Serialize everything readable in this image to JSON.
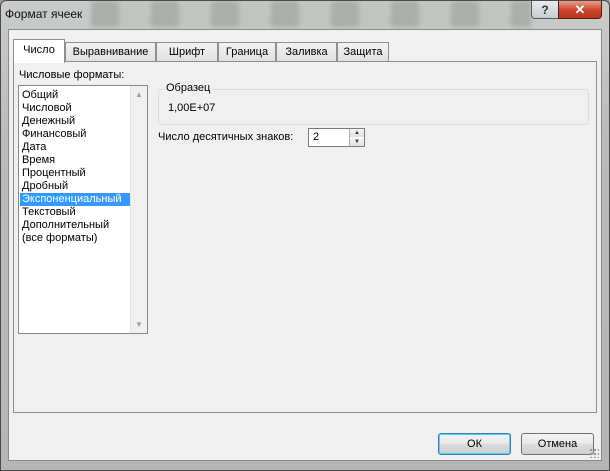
{
  "window": {
    "title": "Формат ячеек",
    "help_label": "?",
    "close_label": "✕"
  },
  "tabs": [
    {
      "label": "Число",
      "active": true
    },
    {
      "label": "Выравнивание",
      "active": false
    },
    {
      "label": "Шрифт",
      "active": false
    },
    {
      "label": "Граница",
      "active": false
    },
    {
      "label": "Заливка",
      "active": false
    },
    {
      "label": "Защита",
      "active": false
    }
  ],
  "number_formats": {
    "label": "Числовые форматы:",
    "items": [
      "Общий",
      "Числовой",
      "Денежный",
      "Финансовый",
      "Дата",
      "Время",
      "Процентный",
      "Дробный",
      "Экспоненциальный",
      "Текстовый",
      "Дополнительный",
      "(все форматы)"
    ],
    "selected": "Экспоненциальный"
  },
  "sample": {
    "legend": "Образец",
    "value": "1,00E+07"
  },
  "decimal_places": {
    "label": "Число десятичных знаков:",
    "value": "2"
  },
  "buttons": {
    "ok": "ОК",
    "cancel": "Отмена"
  },
  "icons": {
    "scroll_up": "▲",
    "scroll_down": "▼",
    "spin_up": "▲",
    "spin_down": "▼"
  },
  "colors": {
    "selection": "#3399ff",
    "close_button": "#c8432a"
  }
}
